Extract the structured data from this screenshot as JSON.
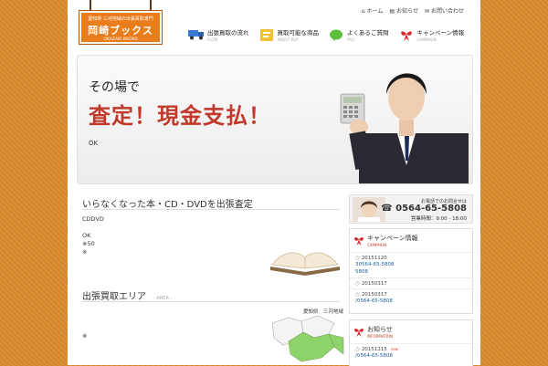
{
  "toplinks": [
    "ホーム",
    "お知らせ",
    "お問い合わせ"
  ],
  "logo": {
    "sub": "愛知県 三河地域の出張買取専門",
    "name": "岡崎ブックス",
    "en": "OKAZAKI BOOKS"
  },
  "nav": [
    {
      "label": "出張買取の流れ",
      "en": "FLOW",
      "icon": "truck-icon"
    },
    {
      "label": "買取可能な商品",
      "en": "ABOUT BUY",
      "icon": "book-icon"
    },
    {
      "label": "よくあるご質問",
      "en": "FAQ",
      "icon": "speech-bubble-icon"
    },
    {
      "label": "キャンペーン情報",
      "en": "CAMPAIGN",
      "icon": "ribbon-icon"
    }
  ],
  "hero": {
    "line1": "その場で",
    "line2": "査定！現金支払！",
    "ok": "OK"
  },
  "section1": {
    "title": "いらなくなった本・CD・DVDを出張査定",
    "lines": [
      "CDDVD",
      "",
      "OK",
      "※50",
      "※"
    ]
  },
  "section2": {
    "title": "出張買取エリア",
    "en": "- AREA -",
    "map_label": "愛知県　三河地域",
    "note": "※"
  },
  "contact": {
    "label": "お電話でのお問合せは",
    "tel": "0564-65-5808",
    "hours": "営業時間：9:00 - 18:00"
  },
  "campaign": {
    "title": "キャンペーン情報",
    "en": "CAMPAIGN",
    "entries": [
      {
        "date": "20151120",
        "link": "30564-65-5808"
      },
      {
        "date": "20150317",
        "link": ""
      },
      {
        "date": "20150317",
        "link": "/0564-65-5808"
      }
    ]
  },
  "news": {
    "title": "お知らせ",
    "en": "INFORMATION",
    "entries": [
      {
        "date": "20151215",
        "badge": "new",
        "link": "/0564-65-5808"
      }
    ]
  },
  "colors": {
    "brand": "#e97d1c",
    "accent_red": "#c0392b",
    "link": "#1b5fa8",
    "bg": "#d98a2d"
  }
}
